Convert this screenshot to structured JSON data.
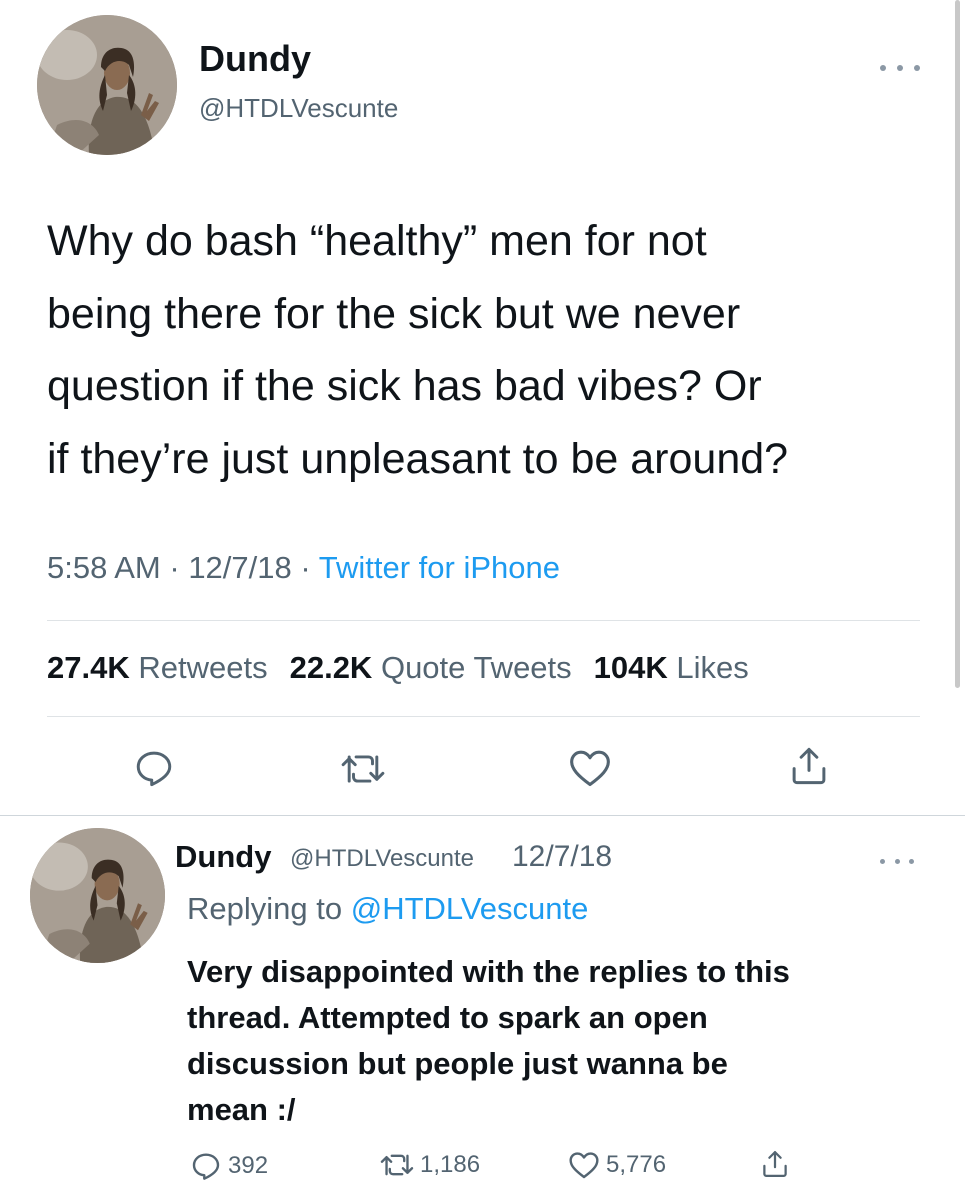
{
  "main_tweet": {
    "author": {
      "display_name": "Dundy",
      "handle": "@HTDLVescunte",
      "avatar_icon": "profile-photo"
    },
    "text": "Why do bash “healthy” men  for not\nbeing there for the sick but we never\nquestion if the sick has bad vibes? Or\nif they’re just unpleasant to be around?",
    "time": "5:58 AM",
    "separator": " · ",
    "date": "12/7/18",
    "source": "Twitter for iPhone",
    "stats": {
      "retweets_count": "27.4K",
      "retweets_label": "Retweets",
      "quotes_count": "22.2K",
      "quotes_label": "Quote Tweets",
      "likes_count": "104K",
      "likes_label": "Likes"
    },
    "actions": [
      "reply-icon",
      "retweet-icon",
      "like-icon",
      "share-icon"
    ]
  },
  "reply_tweet": {
    "author": {
      "display_name": "Dundy",
      "handle": "@HTDLVescunte",
      "avatar_icon": "profile-photo"
    },
    "date": "12/7/18",
    "replying_prefix": "Replying to ",
    "replying_to": "@HTDLVescunte",
    "text": "Very disappointed with the replies to this\nthread. Attempted to spark an open\ndiscussion but people just wanna be\nmean :/",
    "actions": {
      "replies": "392",
      "retweets": "1,186",
      "likes": "5,776"
    }
  },
  "colors": {
    "text": "#0f1419",
    "secondary": "#536471",
    "accent": "#1d9bf0",
    "divider": "#dfe3e6"
  }
}
